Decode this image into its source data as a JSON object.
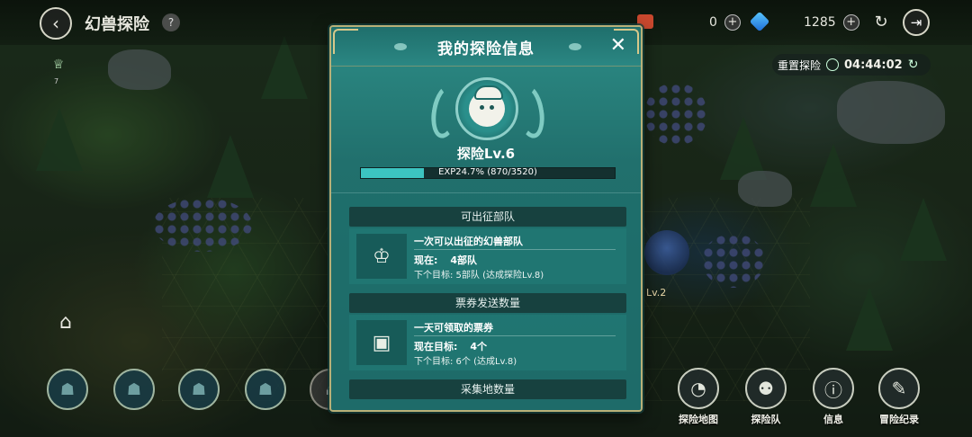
{
  "header": {
    "title": "幻兽探险",
    "help_icon": "question-icon",
    "back_icon": "arrow-left-icon"
  },
  "resources": {
    "ticket_value": "0",
    "gem_value": "1285"
  },
  "reset": {
    "label": "重置探险",
    "time": "04:44:02"
  },
  "left": {
    "badge_count": "7"
  },
  "map": {
    "monster_level": "Lv.2"
  },
  "dialog": {
    "title": "我的探险信息",
    "close_label": "✕",
    "level_label": "探险Lv.6",
    "exp_text": "EXP24.7% (870/3520)",
    "exp_fraction": 0.247,
    "sections": [
      {
        "title": "可出征部队",
        "heading": "一次可以出征的幻兽部队",
        "now_label": "现在:",
        "now_value": "4部队",
        "next": "下个目标: 5部队 (达成探险Lv.8)"
      },
      {
        "title": "票券发送数量",
        "heading": "一天可领取的票券",
        "now_label": "现在目标:",
        "now_value": "4个",
        "next": "下个目标: 6个 (达成Lv.8)"
      },
      {
        "title": "采集地数量"
      }
    ]
  },
  "bottom_nav": {
    "items": [
      {
        "label": "探险地图",
        "icon": "map-icon"
      },
      {
        "label": "探险队",
        "icon": "team-icon"
      },
      {
        "label": "信息",
        "icon": "info-icon"
      },
      {
        "label": "冒险纪录",
        "icon": "record-icon"
      }
    ]
  },
  "colors": {
    "dialog_bg": "#21706d",
    "dialog_border": "#b8b078",
    "exp_fill": "#3cc4c0",
    "section_title_bg": "#17413f"
  }
}
